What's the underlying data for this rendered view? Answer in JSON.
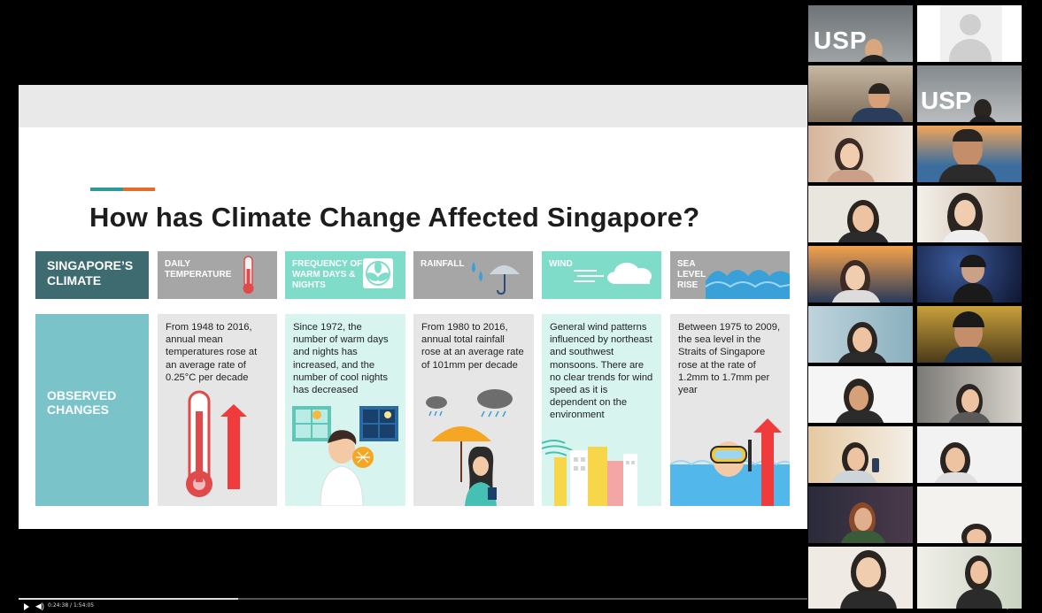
{
  "slide": {
    "title": "How has Climate Change Affected Singapore?",
    "row_climate": "SINGAPORE’S CLIMATE",
    "row_observed": "OBSERVED CHANGES",
    "columns": [
      {
        "head": "DAILY TEMPERATURE",
        "text": "From 1948 to 2016, annual mean temperatures rose at an average rate of 0.25°C per decade"
      },
      {
        "head": "FREQUENCY OF WARM DAYS & NIGHTS",
        "text": "Since 1972, the number of warm days and nights has increased, and the number of cool nights has decreased"
      },
      {
        "head": "RAINFALL",
        "text": "From 1980 to 2016, annual total rainfall rose at an average rate of 101mm per decade"
      },
      {
        "head": "WIND",
        "text": "General wind patterns influenced by northeast and southwest monsoons. There are no clear trends for wind speed as it is dependent on the environment"
      },
      {
        "head": "SEA LEVEL RISE",
        "text": "Between 1975 to 2009, the sea level in the Straits of Singapore rose at the rate of 1.2mm to 1.7mm per year"
      }
    ],
    "colors": {
      "teal_dark": "#3e6b6f",
      "teal_light": "#79c3c9",
      "mint": "#7fdcc8",
      "gray": "#a6a6a6",
      "accent_teal": "#2e9a95",
      "accent_orange": "#e46b2b"
    }
  },
  "player": {
    "time": "0:24:38 / 1:54:05",
    "progress_fraction": 0.28
  },
  "gallery": {
    "tile_labels": [
      "USP",
      "USP"
    ]
  }
}
